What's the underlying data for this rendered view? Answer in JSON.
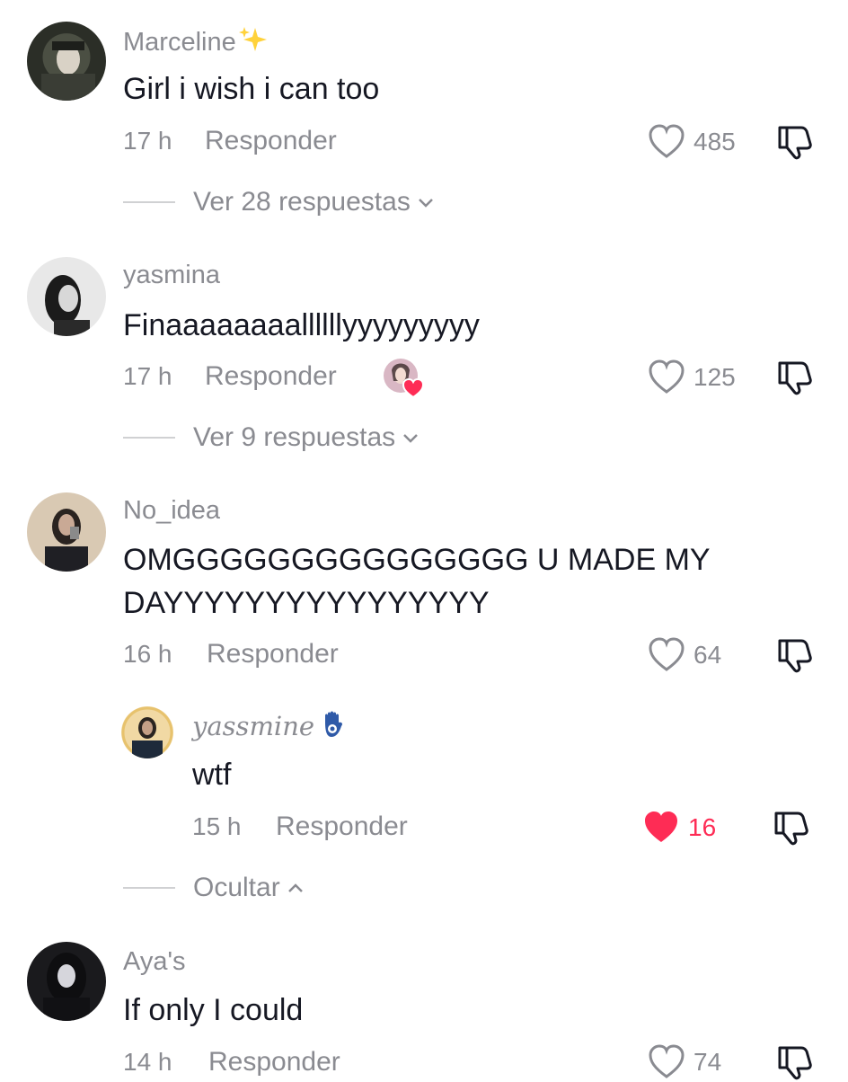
{
  "comments": [
    {
      "username": "Marceline",
      "username_emoji": "✨",
      "text": "Girl i wish i can too",
      "time": "17 h",
      "reply_label": "Responder",
      "likes": "485",
      "liked": false,
      "thread_label": "Ver 28 respuestas"
    },
    {
      "username": "yasmina",
      "text": "Finaaaaaaaallllllyyyyyyyyy",
      "time": "17 h",
      "reply_label": "Responder",
      "creator_liked": true,
      "likes": "125",
      "liked": false,
      "thread_label": "Ver 9 respuestas"
    },
    {
      "username": "No_idea",
      "text_line1": "OMGGGGGGGGGGGGGGG U MADE MY",
      "text_line2": "DAYYYYYYYYYYYYYYYY",
      "time": "16 h",
      "reply_label": "Responder",
      "likes": "64",
      "liked": false,
      "reply": {
        "username": "yassmine",
        "text": "wtf",
        "time": "15 h",
        "reply_label": "Responder",
        "likes": "16",
        "liked": true
      },
      "thread_label": "Ocultar"
    },
    {
      "username": "Aya's",
      "text": "If only I could",
      "time": "14 h",
      "reply_label": "Responder",
      "likes": "74",
      "liked": false
    }
  ],
  "colors": {
    "like_active": "#fe2c55",
    "muted": "#8a8b91",
    "text": "#161823"
  },
  "icons": {
    "like": "heart-outline-icon",
    "liked": "heart-filled-icon",
    "dislike": "thumbs-down-icon",
    "expand": "chevron-down-icon",
    "collapse": "chevron-up-icon",
    "sparkles": "sparkles-icon",
    "hamsa": "hamsa-icon"
  }
}
